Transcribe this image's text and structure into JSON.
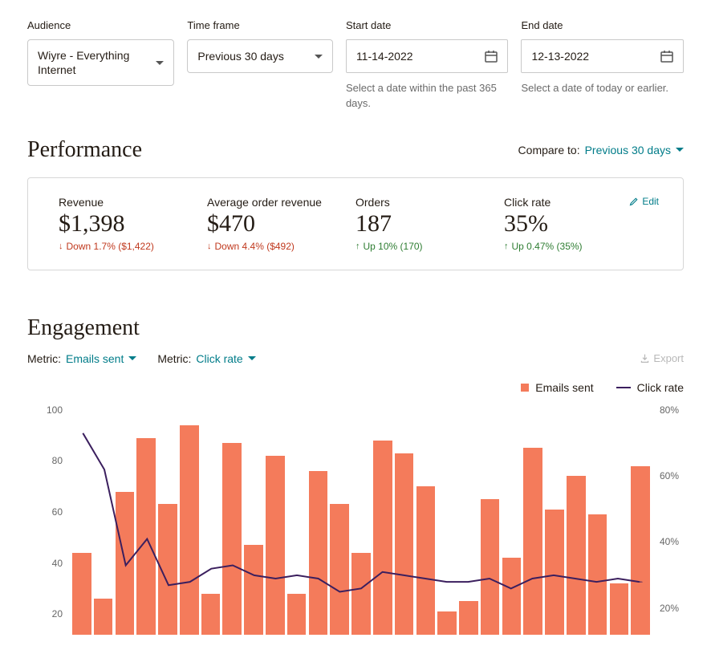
{
  "filters": {
    "audience": {
      "label": "Audience",
      "value": "Wiyre - Everything Internet"
    },
    "timeframe": {
      "label": "Time frame",
      "value": "Previous 30 days"
    },
    "start": {
      "label": "Start date",
      "value": "11-14-2022",
      "hint": "Select a date within the past 365 days."
    },
    "end": {
      "label": "End date",
      "value": "12-13-2022",
      "hint": "Select a date of today or earlier."
    }
  },
  "performance": {
    "title": "Performance",
    "compare_label": "Compare to:",
    "compare_value": "Previous 30 days",
    "edit": "Edit",
    "metrics": {
      "revenue": {
        "label": "Revenue",
        "value": "$1,398",
        "delta": "Down 1.7% ($1,422)",
        "dir": "down"
      },
      "aor": {
        "label": "Average order revenue",
        "value": "$470",
        "delta": "Down 4.4% ($492)",
        "dir": "down"
      },
      "orders": {
        "label": "Orders",
        "value": "187",
        "delta": "Up 10% (170)",
        "dir": "up"
      },
      "click": {
        "label": "Click rate",
        "value": "35%",
        "delta": "Up 0.47% (35%)",
        "dir": "up"
      }
    }
  },
  "engagement": {
    "title": "Engagement",
    "metric1_prefix": "Metric:",
    "metric1": "Emails sent",
    "metric2_prefix": "Metric:",
    "metric2": "Click rate",
    "export": "Export",
    "legend": {
      "bars": "Emails sent",
      "line": "Click rate"
    }
  },
  "chart_data": {
    "type": "bar+line",
    "y_left": {
      "label": "",
      "min": 20,
      "max": 100,
      "ticks": [
        20,
        40,
        60,
        80,
        100
      ]
    },
    "y_right": {
      "label": "",
      "min": 20,
      "max": 80,
      "ticks_labels": [
        "20%",
        "40%",
        "60%",
        "80%"
      ],
      "ticks": [
        20,
        40,
        60,
        80
      ]
    },
    "series": [
      {
        "name": "Emails sent",
        "axis": "left",
        "type": "bar",
        "values": [
          44,
          26,
          68,
          89,
          63,
          94,
          28,
          87,
          47,
          82,
          28,
          76,
          63,
          44,
          88,
          83,
          70,
          21,
          25,
          65,
          42,
          85,
          61,
          74,
          59,
          32,
          78
        ]
      },
      {
        "name": "Click rate",
        "axis": "right",
        "type": "line",
        "values": [
          73,
          62,
          33,
          41,
          27,
          28,
          32,
          33,
          30,
          29,
          30,
          29,
          25,
          26,
          31,
          30,
          29,
          28,
          28,
          29,
          26,
          29,
          30,
          29,
          28,
          29,
          28
        ]
      }
    ]
  }
}
